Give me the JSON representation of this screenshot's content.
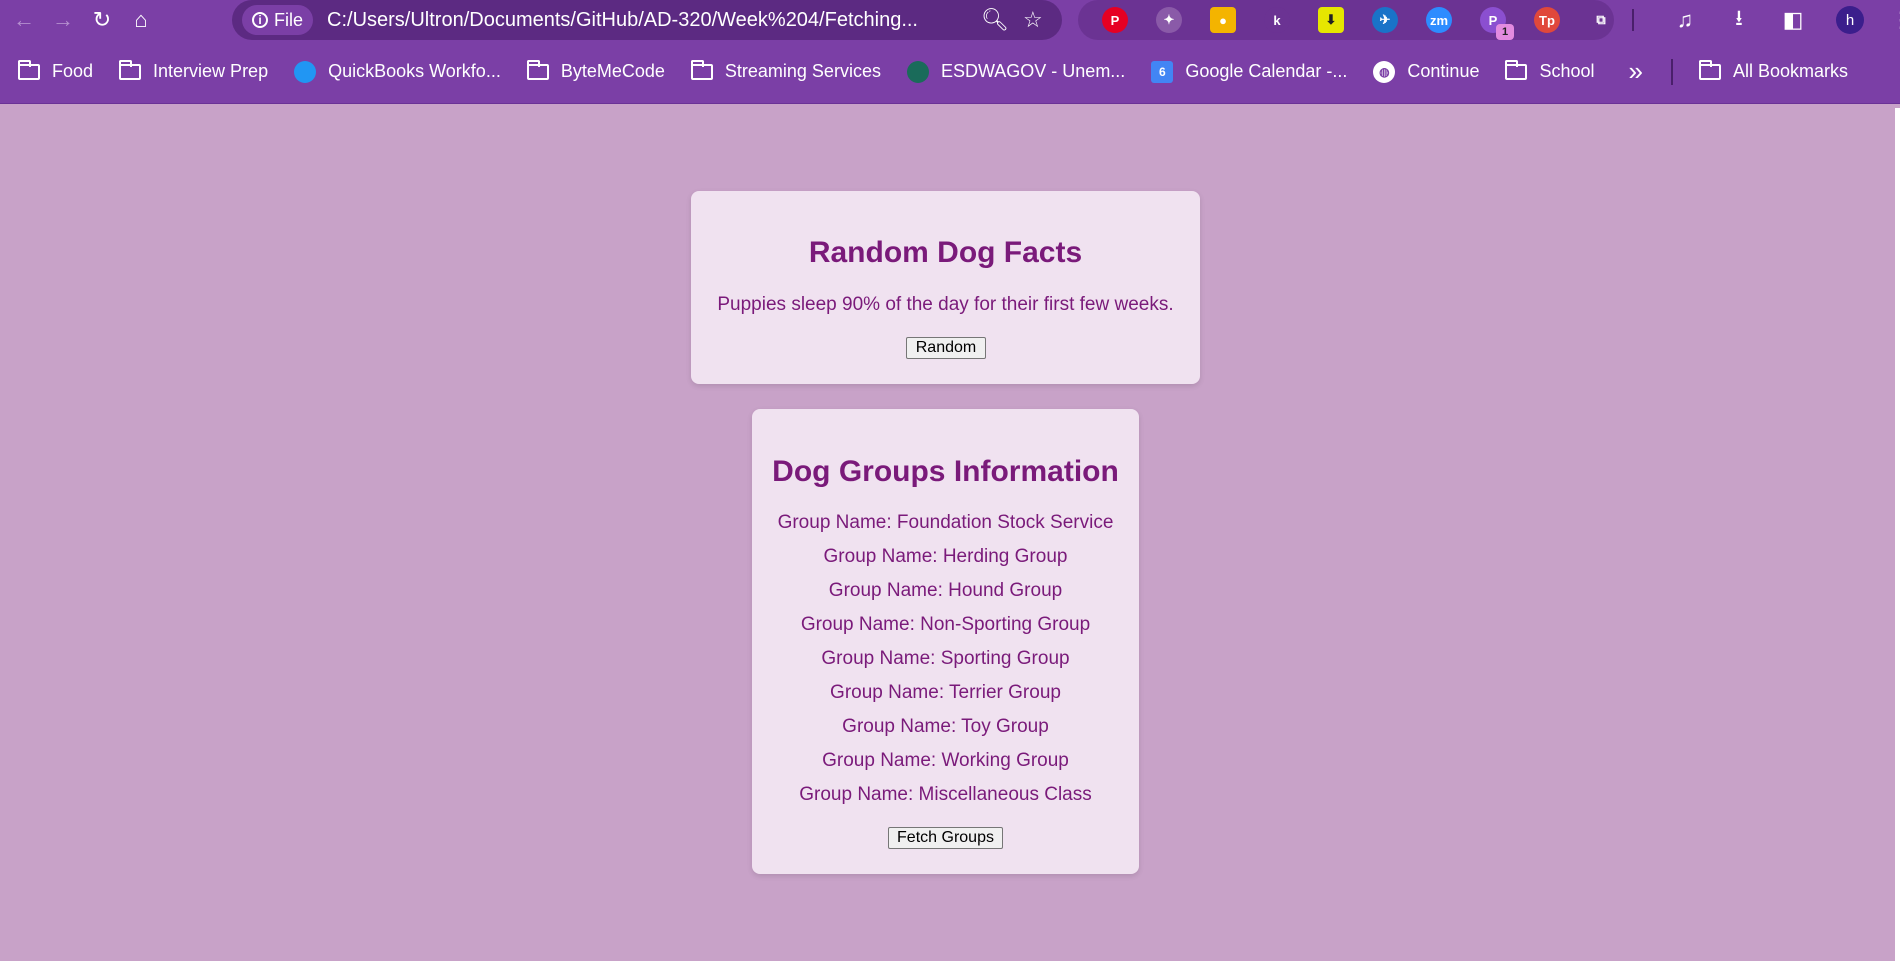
{
  "browser": {
    "site_chip_label": "File",
    "url": "C:/Users/Ultron/Documents/GitHub/AD-320/Week%204/Fetching...",
    "extensions": [
      {
        "name": "pinterest-icon",
        "glyph": "P",
        "color": "#e60023"
      },
      {
        "name": "dropbox-icon",
        "glyph": "✦",
        "color": "#8a5aa8"
      },
      {
        "name": "keep-icon",
        "glyph": "●",
        "color": "#f4b400"
      },
      {
        "name": "kiwi-icon",
        "glyph": "k",
        "color": "#6b3393"
      },
      {
        "name": "download-manager-icon",
        "glyph": "⬇",
        "color": "#e6e600"
      },
      {
        "name": "paperplane-icon",
        "glyph": "✈",
        "color": "#1a73c8"
      },
      {
        "name": "zoom-icon",
        "glyph": "zm",
        "color": "#2d8cff"
      },
      {
        "name": "p-extension-icon",
        "glyph": "P",
        "color": "#8b4fd0",
        "badge": "1"
      },
      {
        "name": "tp-icon",
        "glyph": "Tp",
        "color": "#e0483b"
      },
      {
        "name": "extensions-puzzle-icon",
        "glyph": "⧉",
        "color": "transparent"
      }
    ],
    "profile_initial": "h"
  },
  "bookmarks": [
    {
      "label": "Food",
      "type": "folder"
    },
    {
      "label": "Interview Prep",
      "type": "folder"
    },
    {
      "label": "QuickBooks Workfo...",
      "type": "site",
      "icon": "quickbooks-icon",
      "color": "#2196f3"
    },
    {
      "label": "ByteMeCode",
      "type": "folder"
    },
    {
      "label": "Streaming Services",
      "type": "folder"
    },
    {
      "label": "ESDWAGOV - Unem...",
      "type": "site",
      "icon": "esd-icon",
      "color": "#1a6b5a"
    },
    {
      "label": "Google Calendar -...",
      "type": "site",
      "icon": "calendar-icon",
      "color": "#4285f4"
    },
    {
      "label": "Continue",
      "type": "site",
      "icon": "globe-icon",
      "color": "#ffffff"
    },
    {
      "label": "School",
      "type": "folder"
    }
  ],
  "all_bookmarks_label": "All Bookmarks",
  "page": {
    "facts_card": {
      "title": "Random Dog Facts",
      "fact": "Puppies sleep 90% of the day for their first few weeks.",
      "button_label": "Random"
    },
    "groups_card": {
      "title": "Dog Groups Information",
      "groups": [
        "Group Name: Foundation Stock Service",
        "Group Name: Herding Group",
        "Group Name: Hound Group",
        "Group Name: Non-Sporting Group",
        "Group Name: Sporting Group",
        "Group Name: Terrier Group",
        "Group Name: Toy Group",
        "Group Name: Working Group",
        "Group Name: Miscellaneous Class"
      ],
      "button_label": "Fetch Groups"
    }
  },
  "colors": {
    "page_background": "#c8a2c8",
    "card_background": "#f0e2f0",
    "text_accent": "#7a1a7a",
    "browser_frame": "#7b3fa6"
  }
}
